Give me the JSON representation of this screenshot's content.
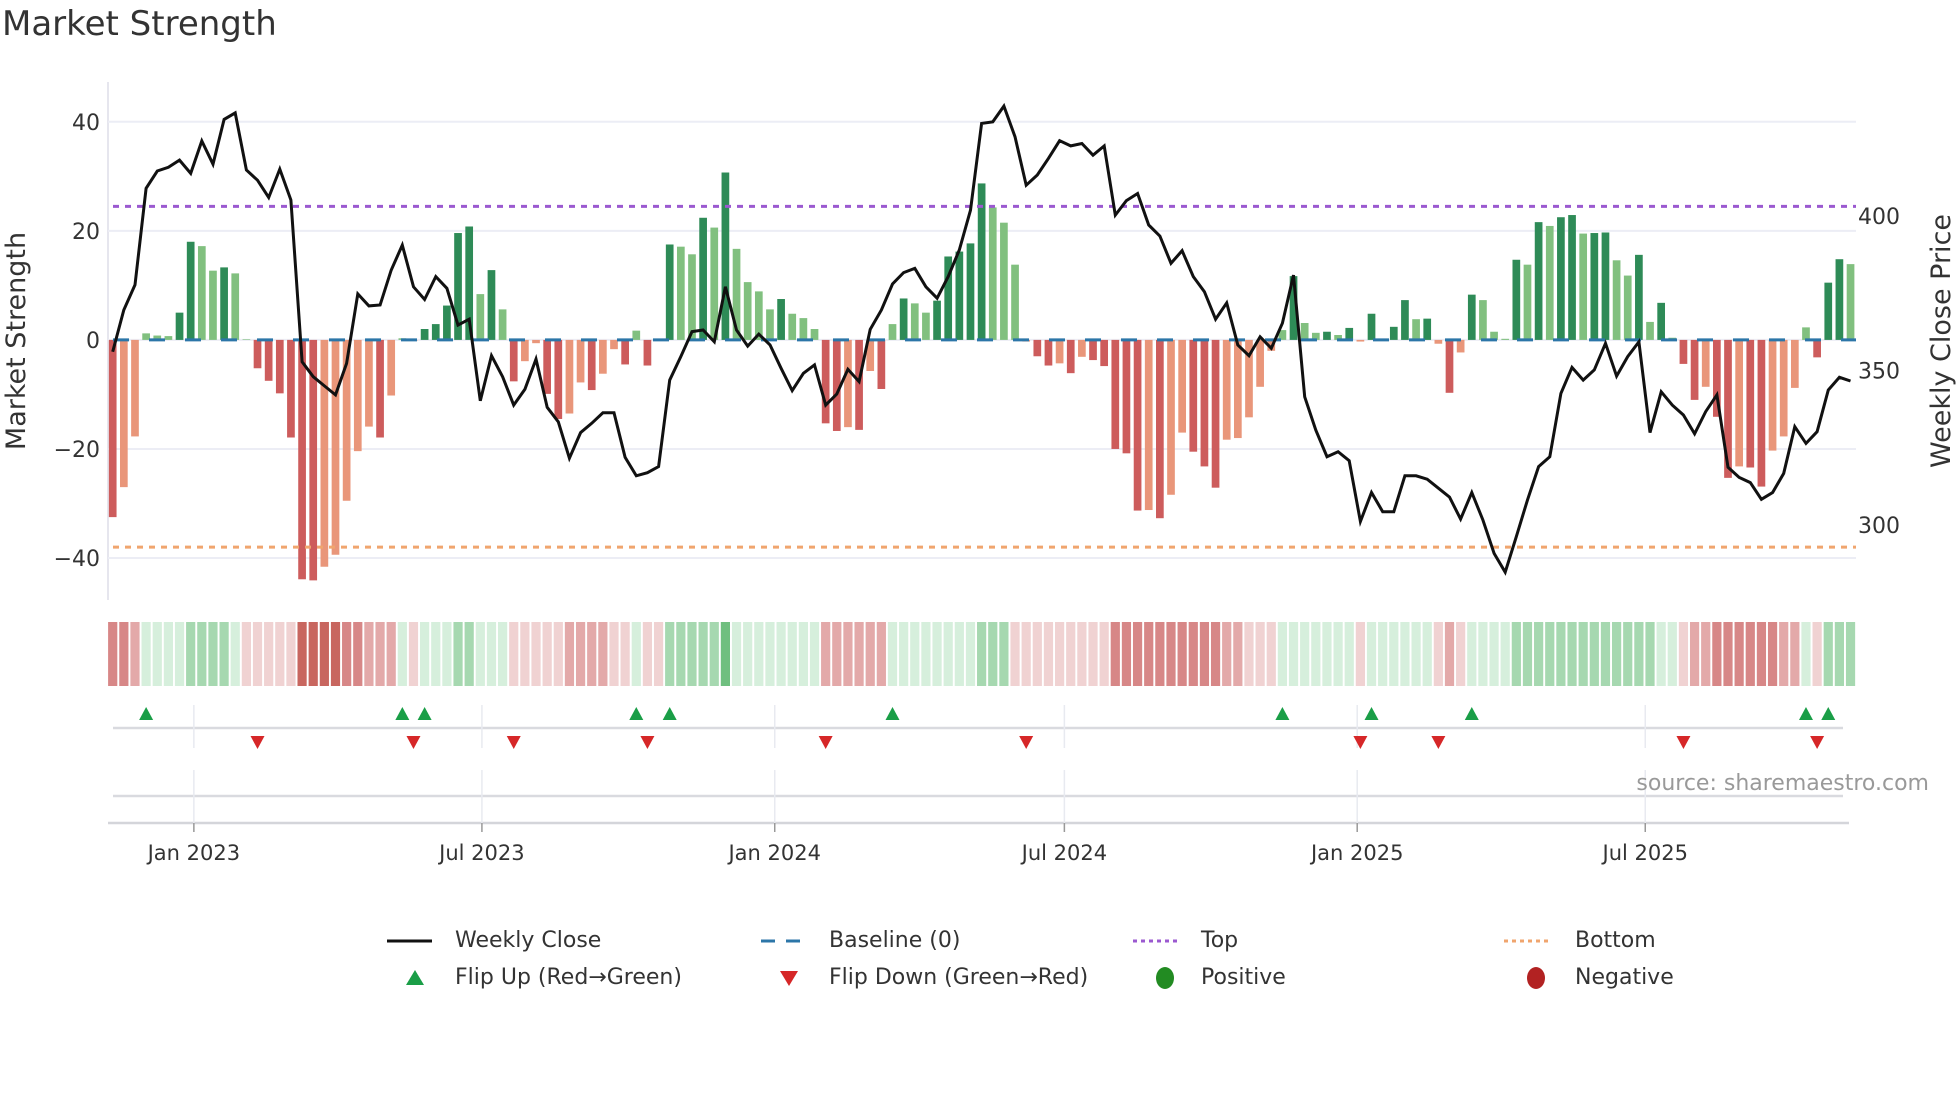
{
  "title": "Market Strength",
  "source": "source: sharemaestro.com",
  "colors": {
    "bar_pos_rising": "#2e8b57",
    "bar_pos_falling": "#81c07f",
    "bar_neg_rising": "#cd5c5c",
    "bar_neg_falling": "#e9967a",
    "line": "#111111",
    "baseline": "#2c76a8",
    "top": "#9b59d0",
    "bottom": "#f0a56e",
    "flip_up": "#1a9e47",
    "flip_down": "#d62728",
    "positive": "#228b22",
    "negative": "#b22222",
    "heat_pos": [
      "#d6efdc",
      "#a6d8b0",
      "#6fbf7f"
    ],
    "heat_neg": [
      "#f0d2d2",
      "#e3a9a9",
      "#d78787",
      "#c8665f"
    ],
    "grid": "#ecedf5"
  },
  "legend": {
    "positive": "Positive",
    "negative": "Negative"
  },
  "chart_data": {
    "type": "bar",
    "ylabel": "Market Strength",
    "y2label": "Weekly Close Price",
    "ylim": [
      -47.7,
      47.3
    ],
    "y2lim": [
      275.7,
      443.4
    ],
    "yticks": [
      40,
      20,
      0,
      -20,
      -40
    ],
    "ytick_labels": [
      "40",
      "20",
      "0",
      "−20",
      "−40"
    ],
    "y2ticks": [
      400,
      350,
      300
    ],
    "y2tick_labels": [
      "400",
      "350",
      "300"
    ],
    "xtick_labels": [
      "Jan 2023",
      "Jul 2023",
      "Jan 2024",
      "Jul 2024",
      "Jan 2025",
      "Jul 2025"
    ],
    "xtick_dates": [
      "2023-01-01",
      "2023-07-01",
      "2024-01-01",
      "2024-07-01",
      "2025-01-01",
      "2025-07-01"
    ],
    "grid": true,
    "legend_position": "bottom",
    "x": [
      "2022-11-11",
      "2022-11-18",
      "2022-11-25",
      "2022-12-02",
      "2022-12-09",
      "2022-12-16",
      "2022-12-23",
      "2022-12-30",
      "2023-01-06",
      "2023-01-13",
      "2023-01-20",
      "2023-01-27",
      "2023-02-03",
      "2023-02-10",
      "2023-02-17",
      "2023-02-24",
      "2023-03-03",
      "2023-03-10",
      "2023-03-17",
      "2023-03-24",
      "2023-03-31",
      "2023-04-07",
      "2023-04-14",
      "2023-04-21",
      "2023-04-28",
      "2023-05-05",
      "2023-05-12",
      "2023-05-19",
      "2023-05-26",
      "2023-06-02",
      "2023-06-09",
      "2023-06-16",
      "2023-06-23",
      "2023-06-30",
      "2023-07-07",
      "2023-07-14",
      "2023-07-21",
      "2023-07-28",
      "2023-08-04",
      "2023-08-11",
      "2023-08-18",
      "2023-08-25",
      "2023-09-01",
      "2023-09-08",
      "2023-09-15",
      "2023-09-22",
      "2023-09-29",
      "2023-10-06",
      "2023-10-13",
      "2023-10-20",
      "2023-10-27",
      "2023-11-03",
      "2023-11-10",
      "2023-11-17",
      "2023-11-24",
      "2023-12-01",
      "2023-12-08",
      "2023-12-15",
      "2023-12-22",
      "2023-12-29",
      "2024-01-05",
      "2024-01-12",
      "2024-01-19",
      "2024-01-26",
      "2024-02-02",
      "2024-02-09",
      "2024-02-16",
      "2024-02-23",
      "2024-03-01",
      "2024-03-08",
      "2024-03-15",
      "2024-03-22",
      "2024-03-29",
      "2024-04-05",
      "2024-04-12",
      "2024-04-19",
      "2024-04-26",
      "2024-05-03",
      "2024-05-10",
      "2024-05-17",
      "2024-05-24",
      "2024-05-31",
      "2024-06-07",
      "2024-06-14",
      "2024-06-21",
      "2024-06-28",
      "2024-07-05",
      "2024-07-12",
      "2024-07-19",
      "2024-07-26",
      "2024-08-02",
      "2024-08-09",
      "2024-08-16",
      "2024-08-23",
      "2024-08-30",
      "2024-09-06",
      "2024-09-13",
      "2024-09-20",
      "2024-09-27",
      "2024-10-04",
      "2024-10-11",
      "2024-10-18",
      "2024-10-25",
      "2024-11-01",
      "2024-11-08",
      "2024-11-15",
      "2024-11-22",
      "2024-11-29",
      "2024-12-06",
      "2024-12-13",
      "2024-12-20",
      "2024-12-27",
      "2025-01-03",
      "2025-01-10",
      "2025-01-17",
      "2025-01-24",
      "2025-01-31",
      "2025-02-07",
      "2025-02-14",
      "2025-02-21",
      "2025-02-28",
      "2025-03-07",
      "2025-03-14",
      "2025-03-21",
      "2025-03-28",
      "2025-04-04",
      "2025-04-11",
      "2025-04-18",
      "2025-04-25",
      "2025-05-02",
      "2025-05-09",
      "2025-05-16",
      "2025-05-23",
      "2025-05-30",
      "2025-06-06",
      "2025-06-13",
      "2025-06-20",
      "2025-06-27",
      "2025-07-04",
      "2025-07-11",
      "2025-07-18",
      "2025-07-25",
      "2025-08-01",
      "2025-08-08",
      "2025-08-15",
      "2025-08-22",
      "2025-08-29",
      "2025-09-05",
      "2025-09-12",
      "2025-09-19",
      "2025-09-26",
      "2025-10-03",
      "2025-10-10",
      "2025-10-17",
      "2025-10-24",
      "2025-10-31",
      "2025-11-07"
    ],
    "strength": [
      -32.5,
      -27,
      -17.7,
      1.2,
      0.8,
      0.7,
      5,
      18,
      17.2,
      12.7,
      13.3,
      12.2,
      0.1,
      -5.2,
      -7.5,
      -9.8,
      -17.9,
      -43.9,
      -44.1,
      -41.6,
      -39.4,
      -29.5,
      -20.4,
      -15.9,
      -17.9,
      -10.2,
      0.3,
      -0.2,
      2.0,
      2.9,
      6.3,
      19.6,
      20.8,
      8.4,
      12.8,
      5.6,
      -7.6,
      -3.9,
      -0.6,
      -9.9,
      -14.5,
      -13.5,
      -7.8,
      -9.2,
      -6.2,
      -1.7,
      -4.5,
      1.7,
      -4.7,
      -0.2,
      17.5,
      17.1,
      15.7,
      22.4,
      20.6,
      30.7,
      16.7,
      10.6,
      8.9,
      5.6,
      7.5,
      4.8,
      4.0,
      2.0,
      -15.3,
      -16.7,
      -16.0,
      -16.5,
      -5.7,
      -9.0,
      2.9,
      7.6,
      6.7,
      5.0,
      7.2,
      15.3,
      16.2,
      17.7,
      28.7,
      24.3,
      21.5,
      13.8,
      -0.3,
      -3.0,
      -4.7,
      -4.3,
      -6.1,
      -3.1,
      -3.7,
      -4.8,
      -20.0,
      -20.8,
      -31.3,
      -31.2,
      -32.7,
      -28.4,
      -17.0,
      -20.5,
      -23.2,
      -27.1,
      -18.3,
      -18.0,
      -14.2,
      -8.6,
      -2.0,
      1.8,
      11.7,
      3.1,
      1.3,
      1.5,
      0.9,
      2.2,
      -0.3,
      4.8,
      0.2,
      2.4,
      7.3,
      3.8,
      3.9,
      -0.7,
      -9.7,
      -2.3,
      8.3,
      7.3,
      1.5,
      0.2,
      14.7,
      13.8,
      21.6,
      20.9,
      22.5,
      22.9,
      19.5,
      19.6,
      19.7,
      14.6,
      11.8,
      15.6,
      3.3,
      6.8,
      0.4,
      -4.4,
      -11.0,
      -8.6,
      -14.1,
      -25.3,
      -23.2,
      -23.4,
      -26.9,
      -20.3,
      -17.7,
      -8.8,
      2.3,
      -3.2,
      10.5,
      14.8,
      13.9
    ],
    "weekly_close": {
      "name": "Weekly Close",
      "values": [
        356.1,
        369.6,
        377.7,
        409.0,
        414.6,
        415.8,
        418.1,
        413.8,
        424.3,
        416.8,
        431.3,
        433.4,
        414.9,
        411.6,
        406.0,
        415.2,
        405.2,
        352.8,
        348.0,
        345.0,
        342.1,
        352.3,
        374.8,
        370.9,
        371.2,
        382.5,
        390.6,
        377.1,
        373.0,
        380.4,
        376.6,
        364.7,
        366.6,
        340.2,
        354.8,
        348.0,
        338.8,
        343.9,
        353.7,
        338.1,
        333.4,
        321.6,
        329.9,
        332.9,
        336.3,
        336.3,
        321.9,
        315.9,
        316.9,
        318.9,
        346.9,
        354.5,
        362.6,
        363.1,
        359.3,
        377.1,
        363.1,
        357.9,
        361.8,
        358.3,
        350.7,
        343.5,
        349.1,
        351.8,
        338.8,
        342.4,
        350.4,
        346.4,
        363.3,
        369.6,
        378.0,
        381.7,
        383.1,
        377.1,
        373.4,
        380.4,
        389.0,
        401.9,
        430.0,
        430.5,
        435.6,
        425.7,
        410.0,
        413.3,
        418.7,
        424.4,
        422.7,
        423.5,
        419.7,
        422.7,
        400.3,
        405.0,
        407.3,
        397.1,
        393.5,
        384.7,
        388.8,
        380.4,
        375.5,
        366.6,
        371.9,
        358.3,
        354.8,
        360.9,
        357.2,
        365.3,
        380.9,
        341.5,
        330.7,
        322.1,
        323.7,
        320.8,
        301.1,
        310.5,
        304.3,
        304.3,
        315.9,
        315.9,
        314.8,
        311.9,
        309.0,
        301.9,
        310.5,
        301.6,
        290.8,
        284.7,
        296.2,
        308.1,
        318.9,
        322.1,
        342.6,
        351.0,
        346.9,
        350.2,
        358.8,
        348.2,
        354.5,
        359.3,
        329.9,
        343.1,
        338.8,
        335.6,
        329.5,
        336.7,
        342.1,
        318.7,
        315.4,
        313.7,
        308.3,
        310.5,
        316.7,
        331.8,
        326.4,
        330.2,
        343.7,
        347.8,
        346.6
      ]
    },
    "baseline": {
      "name": "Baseline (0)",
      "value": 0
    },
    "top": {
      "name": "Top",
      "value": 24.5
    },
    "bottom": {
      "name": "Bottom",
      "value": -38
    },
    "heat": [
      -3,
      -3,
      -2,
      1,
      1,
      1,
      1,
      2,
      2,
      2,
      2,
      1,
      -1,
      -1,
      -1,
      -1,
      -1,
      -4,
      -4,
      -4,
      -4,
      -3,
      -3,
      -2,
      -2,
      -2,
      1,
      -1,
      1,
      1,
      1,
      2,
      2,
      1,
      1,
      1,
      -1,
      -1,
      -1,
      -1,
      -1,
      -2,
      -2,
      -2,
      -2,
      -1,
      -1,
      1,
      -1,
      -1,
      2,
      2,
      2,
      2,
      2,
      3,
      1,
      1,
      1,
      1,
      1,
      1,
      1,
      1,
      -2,
      -2,
      -2,
      -2,
      -2,
      -2,
      1,
      1,
      1,
      1,
      1,
      1,
      1,
      1,
      2,
      2,
      2,
      -1,
      -1,
      -1,
      -1,
      -1,
      -1,
      -1,
      -1,
      -1,
      -3,
      -3,
      -3,
      -3,
      -3,
      -3,
      -3,
      -3,
      -3,
      -3,
      -2,
      -2,
      -1,
      -1,
      -1,
      1,
      1,
      1,
      1,
      1,
      1,
      1,
      -1,
      1,
      1,
      1,
      1,
      1,
      1,
      -1,
      -2,
      -1,
      1,
      1,
      1,
      1,
      2,
      2,
      2,
      2,
      2,
      2,
      2,
      2,
      2,
      2,
      2,
      2,
      2,
      1,
      1,
      -1,
      -2,
      -2,
      -3,
      -3,
      -3,
      -3,
      -3,
      -3,
      -2,
      -2,
      1,
      -1,
      2,
      2,
      2
    ],
    "flip_up": {
      "name": "Flip Up (Red→Green)",
      "dates": [
        "2022-12-02",
        "2023-05-12",
        "2023-05-26",
        "2023-10-06",
        "2023-10-27",
        "2024-03-15",
        "2024-11-15",
        "2025-01-10",
        "2025-03-14",
        "2025-10-10",
        "2025-10-24"
      ]
    },
    "flip_down": {
      "name": "Flip Down (Green→Red)",
      "dates": [
        "2023-02-10",
        "2023-05-19",
        "2023-07-21",
        "2023-10-13",
        "2024-02-02",
        "2024-06-07",
        "2025-01-03",
        "2025-02-21",
        "2025-07-25",
        "2025-10-17"
      ]
    }
  }
}
